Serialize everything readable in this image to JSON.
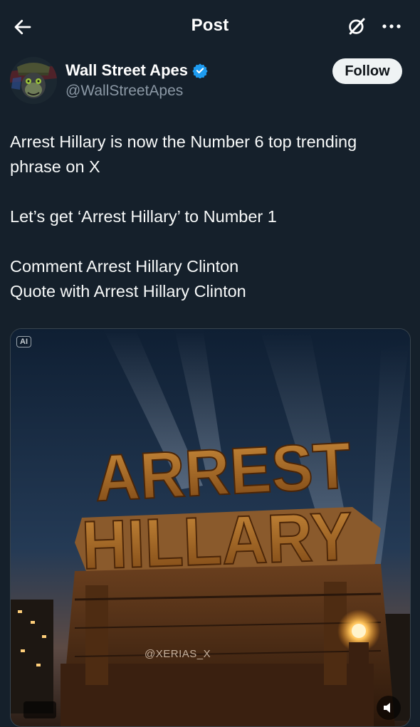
{
  "header": {
    "title": "Post",
    "back_icon": "arrow-left-icon",
    "grok_icon": "grok-icon",
    "more_icon": "more-horizontal-icon"
  },
  "author": {
    "display_name": "Wall Street Apes",
    "handle": "@WallStreetApes",
    "verified": true,
    "verified_color": "#1d9bf0",
    "follow_label": "Follow"
  },
  "post": {
    "lines": [
      "Arrest Hillary is now the Number 6 top trending phrase on X",
      "Let’s get ‘Arrest Hillary’ to Number 1",
      "Comment Arrest Hillary Clinton",
      "Quote with Arrest Hillary Clinton"
    ]
  },
  "media": {
    "ai_label": "AI",
    "headline_top": "ARREST",
    "headline_bottom": "HILLARY",
    "watermark": "@XERIAS_X"
  },
  "colors": {
    "background": "#15202b",
    "text_secondary": "#8b98a5",
    "follow_bg": "#eff3f4"
  }
}
